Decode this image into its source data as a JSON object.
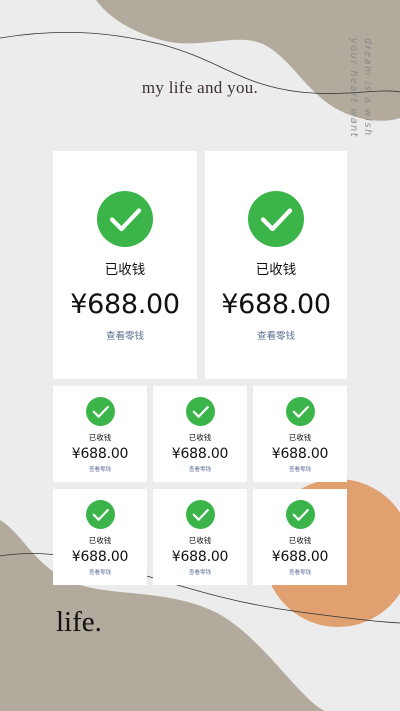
{
  "header": {
    "title": "my life and you."
  },
  "side_text": {
    "line1": "dream is a wish",
    "line2": "your heart want"
  },
  "large_cards": [
    {
      "status": "已收钱",
      "amount": "¥688.00",
      "link": "查看零钱"
    },
    {
      "status": "已收钱",
      "amount": "¥688.00",
      "link": "查看零钱"
    }
  ],
  "small_cards": [
    {
      "status": "已收钱",
      "amount": "¥688.00",
      "link": "查看零钱"
    },
    {
      "status": "已收钱",
      "amount": "¥688.00",
      "link": "查看零钱"
    },
    {
      "status": "已收钱",
      "amount": "¥688.00",
      "link": "查看零钱"
    },
    {
      "status": "已收钱",
      "amount": "¥688.00",
      "link": "查看零钱"
    },
    {
      "status": "已收钱",
      "amount": "¥688.00",
      "link": "查看零钱"
    },
    {
      "status": "已收钱",
      "amount": "¥688.00",
      "link": "查看零钱"
    }
  ],
  "footer": {
    "brand": "life."
  },
  "colors": {
    "background": "#ececec",
    "blob_taupe": "#b2aa9c",
    "blob_orange": "#e0a070",
    "check_green": "#3bb54a",
    "link_blue": "#5a6b94"
  },
  "icons": {
    "check": "check-circle-icon"
  }
}
